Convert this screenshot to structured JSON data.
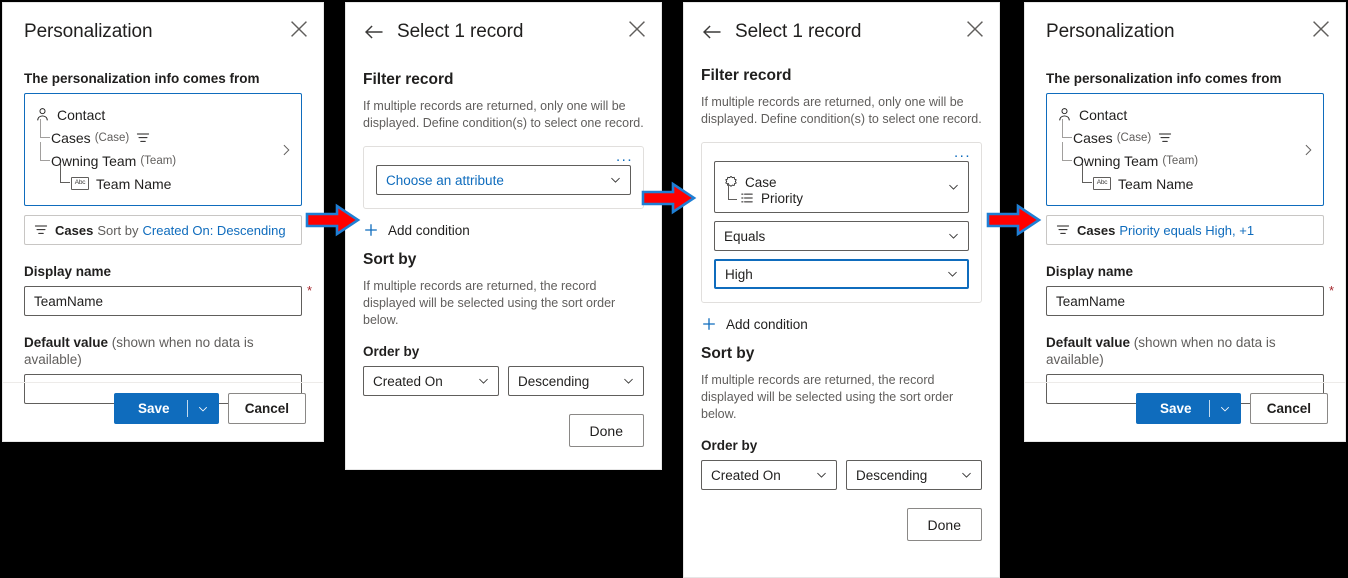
{
  "colors": {
    "accent": "#0f6cbd",
    "link": "#0f6cbd",
    "required": "#a4262c",
    "arrow_fill": "#ff0000",
    "arrow_stroke": "#1f7fd4",
    "background": "#000000",
    "panel": "#ffffff"
  },
  "panel1": {
    "title": "Personalization",
    "close_label": "Close",
    "source_label": "The personalization info comes from",
    "tree": {
      "root": {
        "label": "Contact",
        "icon": "person-icon"
      },
      "children": [
        {
          "label": "Cases",
          "type": "(Case)",
          "icon": "filter-icon"
        },
        {
          "label": "Owning Team",
          "type": "(Team)"
        }
      ],
      "leaf": {
        "label": "Team Name",
        "icon": "abc-icon",
        "icon_text": "Abc"
      },
      "expand_icon": "chevron-right-icon"
    },
    "summary": {
      "entity": "Cases",
      "middle": "Sort by",
      "link": "Created On: Descending"
    },
    "display_name_label": "Display name",
    "display_name_value": "TeamName",
    "required_marker": "*",
    "default_value_label_bold": "Default value",
    "default_value_label_rest": "(shown when no data is available)",
    "default_value_value": "",
    "default_value_placeholder": "",
    "save_label": "Save",
    "save_caret": "chevron-down-icon",
    "cancel_label": "Cancel"
  },
  "panel2": {
    "back_label": "Back",
    "title": "Select 1 record",
    "close_label": "Close",
    "filter_heading": "Filter record",
    "filter_helper": "If multiple records are returned, only one will be displayed. Define condition(s) to select one record.",
    "overflow_label": "...",
    "attribute_value": "Choose an attribute",
    "add_condition_label": "Add condition",
    "sort_heading": "Sort by",
    "sort_helper": "If multiple records are returned, the record displayed will be selected using the sort order below.",
    "order_by_label": "Order by",
    "order_field": "Created On",
    "order_direction": "Descending",
    "done_label": "Done"
  },
  "panel3": {
    "back_label": "Back",
    "title": "Select 1 record",
    "close_label": "Close",
    "filter_heading": "Filter record",
    "filter_helper": "If multiple records are returned, only one will be displayed. Define condition(s) to select one record.",
    "overflow_label": "...",
    "attribute_entity": "Case",
    "attribute_field": "Priority",
    "operator_value": "Equals",
    "operand_value": "High",
    "add_condition_label": "Add condition",
    "sort_heading": "Sort by",
    "sort_helper": "If multiple records are returned, the record displayed will be selected using the sort order below.",
    "order_by_label": "Order by",
    "order_field": "Created On",
    "order_direction": "Descending",
    "done_label": "Done"
  },
  "panel4": {
    "title": "Personalization",
    "close_label": "Close",
    "source_label": "The personalization info comes from",
    "tree": {
      "root": {
        "label": "Contact",
        "icon": "person-icon"
      },
      "children": [
        {
          "label": "Cases",
          "type": "(Case)",
          "icon": "filter-icon"
        },
        {
          "label": "Owning Team",
          "type": "(Team)"
        }
      ],
      "leaf": {
        "label": "Team Name",
        "icon": "abc-icon",
        "icon_text": "Abc"
      },
      "expand_icon": "chevron-right-icon"
    },
    "summary": {
      "entity": "Cases",
      "middle": "",
      "link": "Priority equals High, +1"
    },
    "display_name_label": "Display name",
    "display_name_value": "TeamName",
    "required_marker": "*",
    "default_value_label_bold": "Default value",
    "default_value_label_rest": "(shown when no data is available)",
    "default_value_value": "",
    "save_label": "Save",
    "save_caret": "chevron-down-icon",
    "cancel_label": "Cancel"
  },
  "arrows": [
    {
      "name": "arrow-step-1-to-2"
    },
    {
      "name": "arrow-step-2-to-3"
    },
    {
      "name": "arrow-step-3-to-4"
    }
  ]
}
